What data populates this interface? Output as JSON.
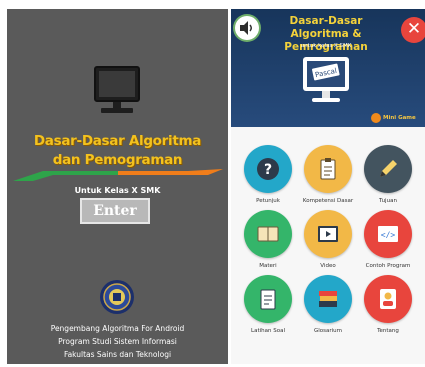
{
  "splash": {
    "title_line1": "Dasar-Dasar Algoritma",
    "title_line2": "dan Pemograman",
    "subtitle": "Untuk Kelas X SMK",
    "enter_label": "Enter",
    "footer_line1": "Pengembang Algoritma For Android",
    "footer_line2": "Program Studi Sistem Informasi",
    "footer_line3": "Fakultas Sains dan Teknologi"
  },
  "menu": {
    "title_line1": "Dasar-Dasar",
    "title_line2": "Algoritma & Pemrograman",
    "subtitle": "untuk kelas X SMK",
    "monitor_text": "Pascal",
    "close_glyph": "✕",
    "minigame_label": "Mini Game",
    "items": [
      {
        "label": "Petunjuk",
        "color": "#23a7c9",
        "icon": "question-icon"
      },
      {
        "label": "Kompetensi Dasar",
        "color": "#f2b847",
        "icon": "clipboard-icon"
      },
      {
        "label": "Tujuan",
        "color": "#43545f",
        "icon": "pencil-icon"
      },
      {
        "label": "Materi",
        "color": "#34b56a",
        "icon": "book-icon"
      },
      {
        "label": "Video",
        "color": "#f2b847",
        "icon": "video-icon"
      },
      {
        "label": "Contoh Program",
        "color": "#e8453d",
        "icon": "code-icon"
      },
      {
        "label": "Latihan Soal",
        "color": "#34b56a",
        "icon": "exercise-icon"
      },
      {
        "label": "Glosarium",
        "color": "#23a7c9",
        "icon": "books-icon"
      },
      {
        "label": "Tentang",
        "color": "#e8453d",
        "icon": "about-icon"
      }
    ]
  }
}
